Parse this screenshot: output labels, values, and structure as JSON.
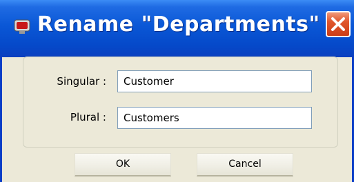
{
  "window": {
    "title": "Rename \"Departments\"",
    "icon": "app-icon",
    "close_icon": "close-icon"
  },
  "form": {
    "singular": {
      "label": "Singular :",
      "value": "Customer"
    },
    "plural": {
      "label": "Plural :",
      "value": "Customers"
    }
  },
  "buttons": {
    "ok": "OK",
    "cancel": "Cancel"
  },
  "colors": {
    "titlebar": "#0a57d6",
    "close": "#e0562c",
    "dialog_bg": "#ece9d8",
    "field_border": "#7f9db9"
  }
}
